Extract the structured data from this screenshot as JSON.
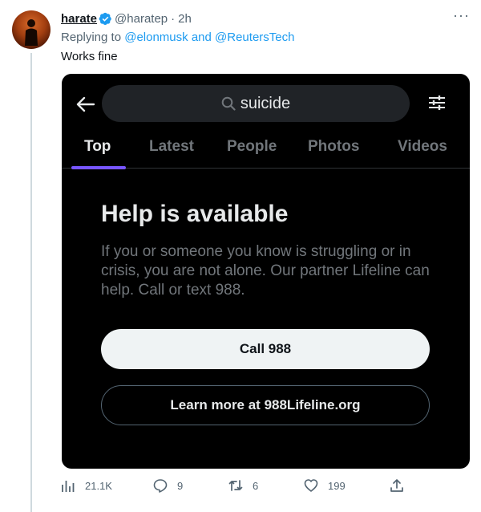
{
  "tweet": {
    "display_name": "harate",
    "handle": "@haratep",
    "separator": "·",
    "time": "2h",
    "more_label": "···",
    "replying_prefix": "Replying to ",
    "replying_mention_1": "@elonmusk",
    "replying_and": " and ",
    "replying_mention_2": "@ReutersTech",
    "text": "Works fine"
  },
  "screenshot": {
    "search_query": "suicide",
    "tabs": [
      {
        "label": "Top",
        "active": true
      },
      {
        "label": "Latest",
        "active": false
      },
      {
        "label": "People",
        "active": false
      },
      {
        "label": "Photos",
        "active": false
      },
      {
        "label": "Videos",
        "active": false
      }
    ],
    "help_title": "Help is available",
    "help_body": "If you or someone you know is struggling or in crisis, you are not alone. Our partner Lifeline can help. Call or text 988.",
    "call_button": "Call 988",
    "learn_button": "Learn more at 988Lifeline.org"
  },
  "actions": {
    "views": "21.1K",
    "replies": "9",
    "retweets": "6",
    "likes": "199"
  },
  "colors": {
    "accent": "#1d9bf0",
    "tab_indicator": "#7856ff",
    "screenshot_bg": "#000000",
    "muted": "#536471"
  },
  "icons": [
    "verified-badge-icon",
    "more-icon",
    "back-arrow-icon",
    "search-icon",
    "filter-icon",
    "views-icon",
    "reply-icon",
    "retweet-icon",
    "like-icon",
    "share-icon"
  ]
}
